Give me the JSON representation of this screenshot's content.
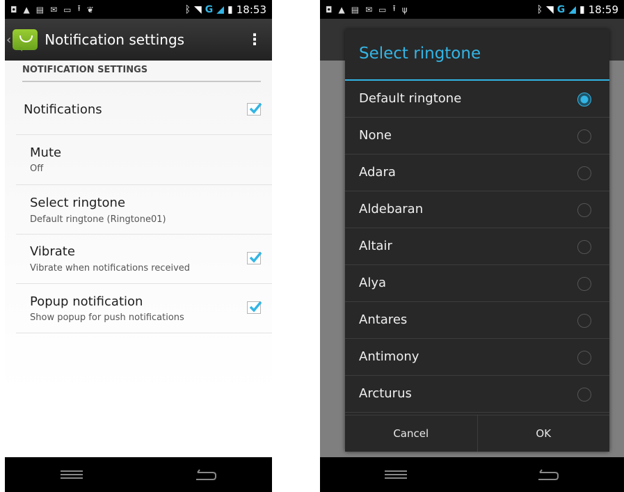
{
  "left": {
    "status": {
      "clock": "18:53",
      "network": "G"
    },
    "actionbar": {
      "title": "Notification settings"
    },
    "section_header": "NOTIFICATION SETTINGS",
    "prefs": {
      "notifications": {
        "title": "Notifications",
        "checked": true
      },
      "mute": {
        "title": "Mute",
        "summary": "Off"
      },
      "ringtone": {
        "title": "Select ringtone",
        "summary": "Default ringtone (Ringtone01)"
      },
      "vibrate": {
        "title": "Vibrate",
        "summary": "Vibrate when notifications received",
        "checked": true
      },
      "popup": {
        "title": "Popup notification",
        "summary": "Show popup for push notifications",
        "checked": true
      }
    }
  },
  "right": {
    "status": {
      "clock": "18:59",
      "network": "G"
    },
    "dialog": {
      "title": "Select ringtone",
      "items": [
        {
          "label": "Default ringtone",
          "selected": true
        },
        {
          "label": "None",
          "selected": false
        },
        {
          "label": "Adara",
          "selected": false
        },
        {
          "label": "Aldebaran",
          "selected": false
        },
        {
          "label": "Altair",
          "selected": false
        },
        {
          "label": "Alya",
          "selected": false
        },
        {
          "label": "Antares",
          "selected": false
        },
        {
          "label": "Antimony",
          "selected": false
        },
        {
          "label": "Arcturus",
          "selected": false
        }
      ],
      "cancel_label": "Cancel",
      "ok_label": "OK"
    }
  },
  "colors": {
    "accent": "#33b5e5",
    "dialog_bg": "#282828",
    "actionbar_bg": "#222222"
  }
}
